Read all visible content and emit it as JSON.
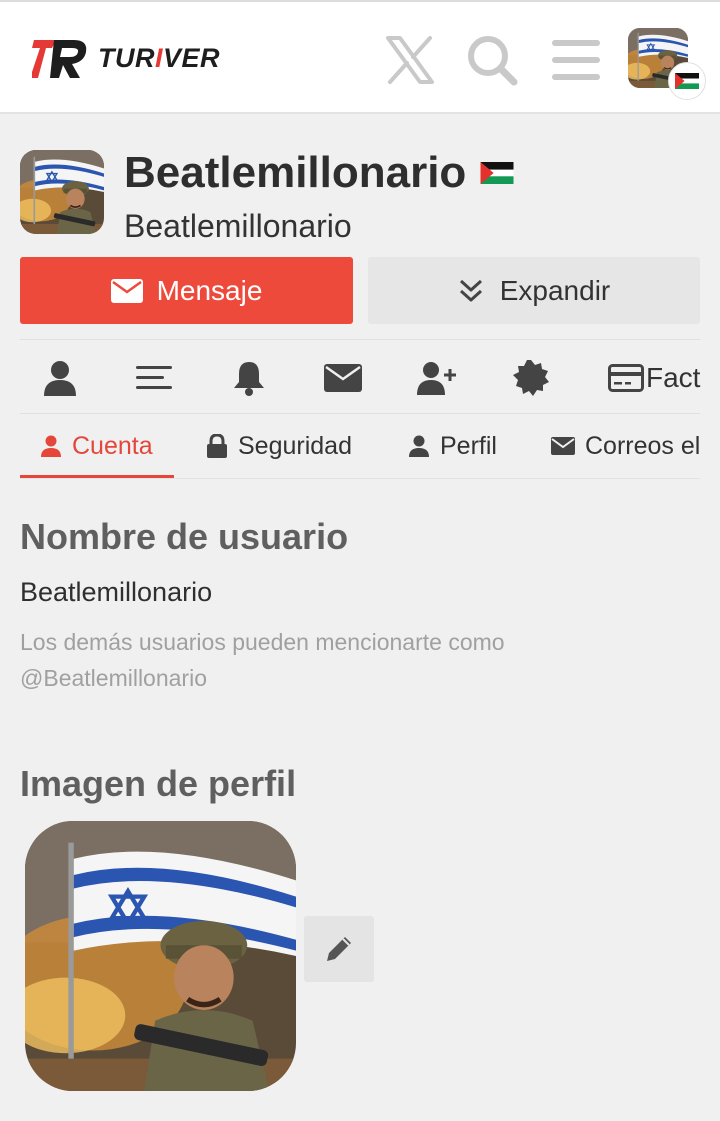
{
  "header": {
    "brand_prefix": "TUR",
    "brand_accent": "I",
    "brand_suffix": "VER",
    "icons": [
      "x-icon",
      "search-icon",
      "menu-icon",
      "avatar"
    ]
  },
  "profile": {
    "display_name": "Beatlemillonario",
    "username": "Beatlemillonario",
    "flag": "palestine-flag-icon"
  },
  "actions": {
    "message_label": "Mensaje",
    "expand_label": "Expandir"
  },
  "icon_nav": {
    "items": [
      "user-icon",
      "list-icon",
      "bell-icon",
      "envelope-icon",
      "user-plus-icon",
      "badge-icon",
      "credit-card-icon"
    ],
    "fact_label": "Fact"
  },
  "tabs": [
    {
      "label": "Cuenta",
      "icon": "user-icon",
      "active": true
    },
    {
      "label": "Seguridad",
      "icon": "lock-icon",
      "active": false
    },
    {
      "label": "Perfil",
      "icon": "user-icon",
      "active": false
    },
    {
      "label": "Correos el",
      "icon": "envelope-icon",
      "active": false
    }
  ],
  "username_section": {
    "heading": "Nombre de usuario",
    "value": "Beatlemillonario",
    "hint_line1": "Los demás usuarios pueden mencionarte como",
    "hint_line2": "@Beatlemillonario"
  },
  "avatar_section": {
    "heading": "Imagen de perfil"
  },
  "colors": {
    "accent": "#ee4a3c",
    "background": "#f0f0f0",
    "secondary_button": "#e6e6e6"
  }
}
